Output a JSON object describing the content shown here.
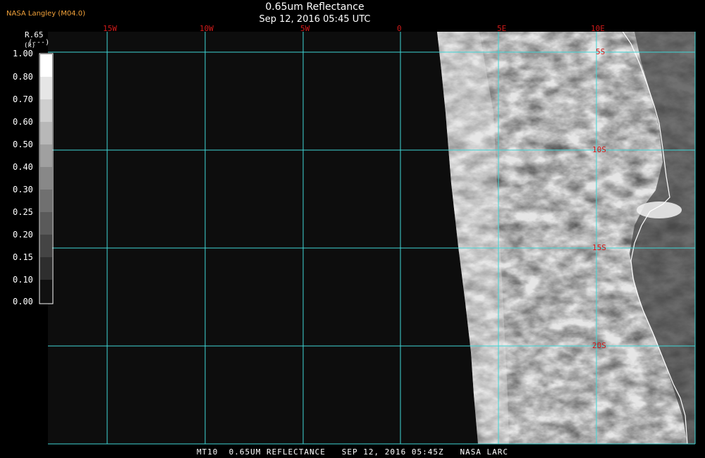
{
  "header": {
    "credit": "NASA Langley (M04.0)",
    "title": "0.65um Reflectance",
    "datetime": "Sep 12, 2016 05:45 UTC"
  },
  "legend": {
    "channel": "R.65",
    "unit_top": "(---)",
    "unit_small": "(k)",
    "levels": [
      "1.00",
      "0.80",
      "0.70",
      "0.60",
      "0.50",
      "0.40",
      "0.30",
      "0.25",
      "0.20",
      "0.15",
      "0.10",
      "0.00"
    ]
  },
  "grid": {
    "longitudes": [
      "15W",
      "10W",
      "5W",
      "0",
      "5E",
      "10E"
    ],
    "latitudes": [
      "5S",
      "10S",
      "15S",
      "20S"
    ]
  },
  "footer": {
    "text": "MT10  0.65UM REFLECTANCE   SEP 12, 2016 05:45Z   NASA LARC"
  },
  "colors": {
    "grid": "#3fd6d6",
    "label": "#d11a1a",
    "credit": "#f2a23a",
    "background": "#0d0d0d"
  }
}
